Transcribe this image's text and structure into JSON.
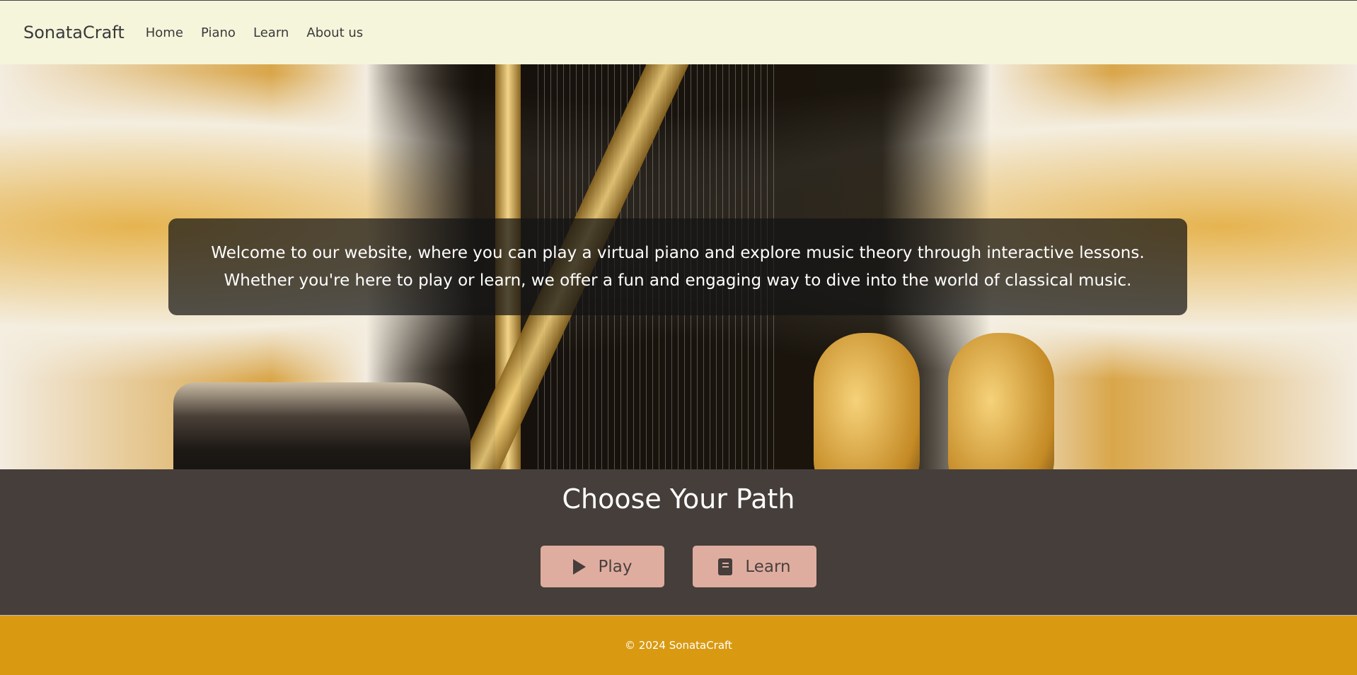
{
  "nav": {
    "brand": "SonataCraft",
    "items": [
      {
        "label": "Home"
      },
      {
        "label": "Piano"
      },
      {
        "label": "Learn"
      },
      {
        "label": "About us"
      }
    ]
  },
  "hero": {
    "line1": "Welcome to our website, where you can play a virtual piano and explore music theory through interactive lessons.",
    "line2": "Whether you're here to play or learn, we offer a fun and engaging way to dive into the world of classical music."
  },
  "choose": {
    "title": "Choose Your Path",
    "buttons": [
      {
        "label": "Play",
        "icon": "play-icon"
      },
      {
        "label": "Learn",
        "icon": "book-icon"
      }
    ]
  },
  "footer": {
    "text": "© 2024 SonataCraft"
  },
  "colors": {
    "navbar": "#f5f5dc",
    "section": "#463e3a",
    "button": "#dfada0",
    "footer": "#d99a12"
  }
}
